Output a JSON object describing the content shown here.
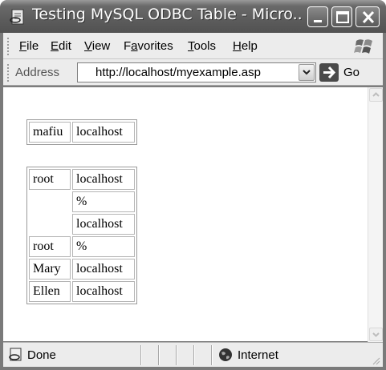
{
  "window": {
    "title": "Testing MySQL ODBC Table - Micro..."
  },
  "menu": {
    "items": [
      {
        "label": "File",
        "underline": "F",
        "rest": "ile"
      },
      {
        "label": "Edit",
        "underline": "E",
        "rest": "dit"
      },
      {
        "label": "View",
        "underline": "V",
        "rest": "iew"
      },
      {
        "label": "Favorites",
        "pre": "F",
        "underline": "a",
        "rest": "vorites"
      },
      {
        "label": "Tools",
        "underline": "T",
        "rest": "ools"
      },
      {
        "label": "Help",
        "underline": "H",
        "rest": "elp"
      }
    ]
  },
  "address": {
    "label": "Address",
    "url": "http://localhost/myexample.asp",
    "go_label": "Go"
  },
  "tables": [
    {
      "rows": [
        [
          "mafiu",
          "localhost"
        ]
      ]
    },
    {
      "rows": [
        [
          "root",
          "localhost"
        ],
        [
          "",
          "%"
        ],
        [
          "",
          "localhost"
        ],
        [
          "root",
          "%"
        ],
        [
          "Mary",
          "localhost"
        ],
        [
          "Ellen",
          "localhost"
        ]
      ]
    }
  ],
  "status": {
    "text": "Done",
    "zone": "Internet"
  },
  "icons": {
    "title": "ie-page-icon",
    "status": "page-icon",
    "zone": "globe-icon",
    "brand": "windows-logo-icon"
  }
}
